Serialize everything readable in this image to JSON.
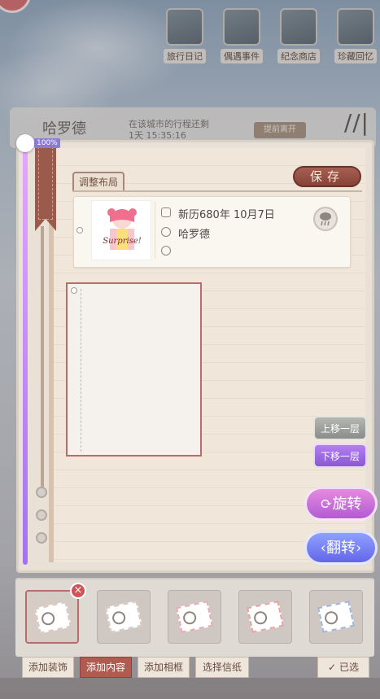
{
  "top_nav": [
    {
      "label": "旅行日记",
      "icon": "journal-icon"
    },
    {
      "label": "偶遇事件",
      "icon": "newspaper-icon"
    },
    {
      "label": "纪念商店",
      "icon": "shop-icon"
    },
    {
      "label": "珍藏回忆",
      "icon": "album-icon"
    }
  ],
  "background": {
    "name": "哈罗德",
    "trip_line1": "在该城市的行程还剩",
    "trip_line2": "1天 15:35:16",
    "leave_button": "提前离开"
  },
  "zoom": {
    "label": "100%",
    "value": 1.0
  },
  "layout_tab": "调整布局",
  "save_label": "保存",
  "entry": {
    "sticker_text": "Surprise!",
    "date": "新历680年 10月7日",
    "city": "哈罗德",
    "weather_icon": "rain-cloud-icon"
  },
  "actions": {
    "move_up": "上移一层",
    "move_down": "下移一层",
    "rotate": "旋转",
    "flip": "翻转"
  },
  "tray_items": [
    {
      "icon": "stamp-icon",
      "selected": true
    },
    {
      "icon": "stamp-icon",
      "selected": false
    },
    {
      "icon": "stamp-icon",
      "selected": false
    },
    {
      "icon": "stamp-icon",
      "selected": false
    },
    {
      "icon": "stamp-icon",
      "selected": false
    }
  ],
  "bottom_tabs": {
    "add_decoration": "添加装饰",
    "add_content": "添加内容",
    "add_frame": "添加相框",
    "choose_paper": "选择信纸",
    "selected": "已选"
  },
  "colors": {
    "accent": "#b05a50",
    "purple": "#8b58d6",
    "blue": "#6366e8",
    "paper": "#f0e6da"
  }
}
